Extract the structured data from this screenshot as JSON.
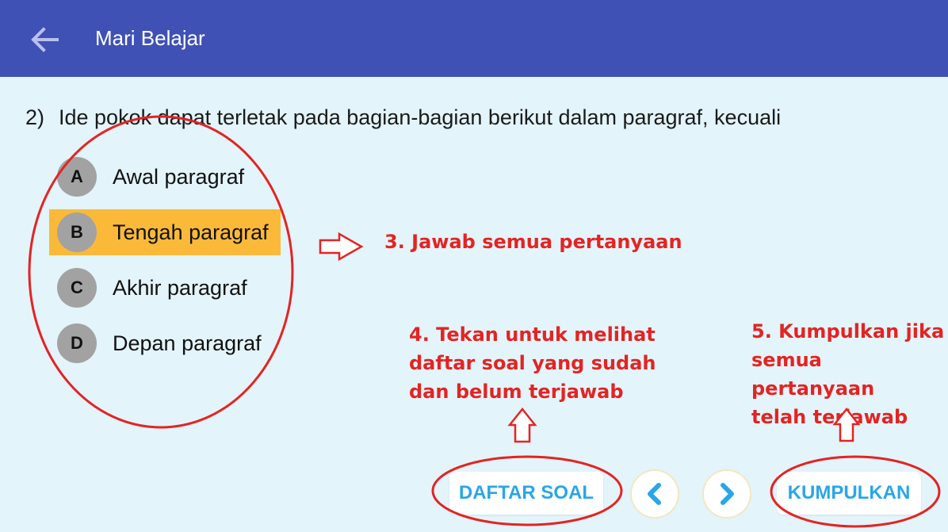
{
  "header": {
    "title": "Mari Belajar",
    "back_icon": "arrow-left-icon"
  },
  "question": {
    "number": "2)",
    "text": "Ide pokok dapat terletak pada bagian-bagian berikut dalam paragraf, kecuali"
  },
  "options": [
    {
      "letter": "A",
      "text": "Awal paragraf",
      "selected": false
    },
    {
      "letter": "B",
      "text": "Tengah paragraf",
      "selected": true
    },
    {
      "letter": "C",
      "text": "Akhir paragraf",
      "selected": false
    },
    {
      "letter": "D",
      "text": "Depan paragraf",
      "selected": false
    }
  ],
  "annotations": {
    "step3": "3. Jawab semua pertanyaan",
    "step4": [
      "4. Tekan untuk melihat",
      "daftar soal yang sudah",
      "dan belum terjawab"
    ],
    "step5": [
      "5. Kumpulkan jika",
      "semua pertanyaan",
      "telah terjawab"
    ]
  },
  "footer": {
    "daftar_soal_label": "DAFTAR SOAL",
    "kumpulkan_label": "KUMPULKAN",
    "prev_icon": "chevron-left-icon",
    "next_icon": "chevron-right-icon"
  },
  "colors": {
    "appbar": "#3f51b5",
    "background": "#e3f4fa",
    "selected_option": "#fbb93a",
    "annotation_red": "#e32423",
    "button_text": "#29a6e8"
  }
}
